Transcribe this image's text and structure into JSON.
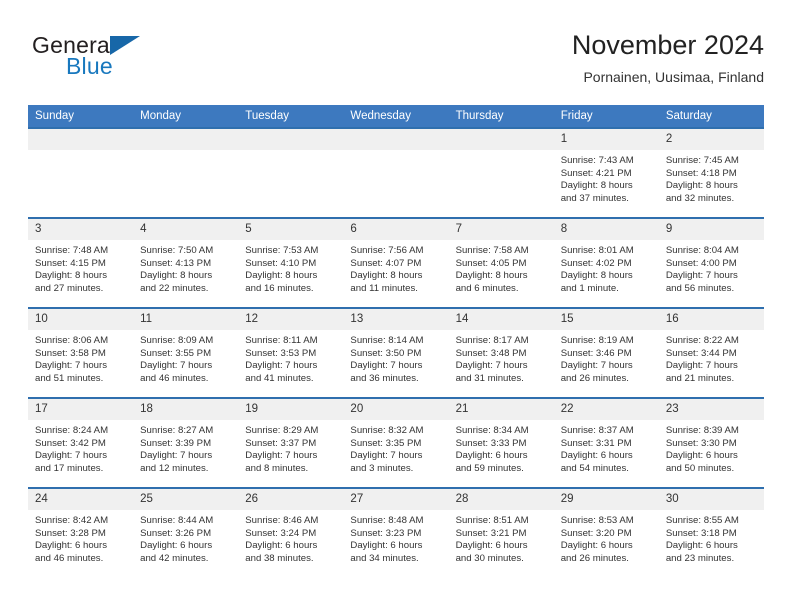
{
  "brand": {
    "name_part1": "General",
    "name_part2": "Blue",
    "logo_icon": "triangle-logo-icon"
  },
  "header": {
    "title": "November 2024",
    "subtitle": "Pornainen, Uusimaa, Finland"
  },
  "colors": {
    "header_blue": "#3d79bf",
    "row_border_blue": "#2f6fae",
    "daynum_band": "#f0f0f0",
    "brand_blue": "#1878be",
    "text": "#333333"
  },
  "weekday_headers": [
    "Sunday",
    "Monday",
    "Tuesday",
    "Wednesday",
    "Thursday",
    "Friday",
    "Saturday"
  ],
  "labels": {
    "sunrise": "Sunrise:",
    "sunset": "Sunset:",
    "daylight": "Daylight:"
  },
  "weeks": [
    [
      {
        "day": "",
        "empty": true
      },
      {
        "day": "",
        "empty": true
      },
      {
        "day": "",
        "empty": true
      },
      {
        "day": "",
        "empty": true
      },
      {
        "day": "",
        "empty": true
      },
      {
        "day": "1",
        "sunrise": "Sunrise: 7:43 AM",
        "sunset": "Sunset: 4:21 PM",
        "daylight_line1": "Daylight: 8 hours",
        "daylight_line2": "and 37 minutes."
      },
      {
        "day": "2",
        "sunrise": "Sunrise: 7:45 AM",
        "sunset": "Sunset: 4:18 PM",
        "daylight_line1": "Daylight: 8 hours",
        "daylight_line2": "and 32 minutes."
      }
    ],
    [
      {
        "day": "3",
        "sunrise": "Sunrise: 7:48 AM",
        "sunset": "Sunset: 4:15 PM",
        "daylight_line1": "Daylight: 8 hours",
        "daylight_line2": "and 27 minutes."
      },
      {
        "day": "4",
        "sunrise": "Sunrise: 7:50 AM",
        "sunset": "Sunset: 4:13 PM",
        "daylight_line1": "Daylight: 8 hours",
        "daylight_line2": "and 22 minutes."
      },
      {
        "day": "5",
        "sunrise": "Sunrise: 7:53 AM",
        "sunset": "Sunset: 4:10 PM",
        "daylight_line1": "Daylight: 8 hours",
        "daylight_line2": "and 16 minutes."
      },
      {
        "day": "6",
        "sunrise": "Sunrise: 7:56 AM",
        "sunset": "Sunset: 4:07 PM",
        "daylight_line1": "Daylight: 8 hours",
        "daylight_line2": "and 11 minutes."
      },
      {
        "day": "7",
        "sunrise": "Sunrise: 7:58 AM",
        "sunset": "Sunset: 4:05 PM",
        "daylight_line1": "Daylight: 8 hours",
        "daylight_line2": "and 6 minutes."
      },
      {
        "day": "8",
        "sunrise": "Sunrise: 8:01 AM",
        "sunset": "Sunset: 4:02 PM",
        "daylight_line1": "Daylight: 8 hours",
        "daylight_line2": "and 1 minute."
      },
      {
        "day": "9",
        "sunrise": "Sunrise: 8:04 AM",
        "sunset": "Sunset: 4:00 PM",
        "daylight_line1": "Daylight: 7 hours",
        "daylight_line2": "and 56 minutes."
      }
    ],
    [
      {
        "day": "10",
        "sunrise": "Sunrise: 8:06 AM",
        "sunset": "Sunset: 3:58 PM",
        "daylight_line1": "Daylight: 7 hours",
        "daylight_line2": "and 51 minutes."
      },
      {
        "day": "11",
        "sunrise": "Sunrise: 8:09 AM",
        "sunset": "Sunset: 3:55 PM",
        "daylight_line1": "Daylight: 7 hours",
        "daylight_line2": "and 46 minutes."
      },
      {
        "day": "12",
        "sunrise": "Sunrise: 8:11 AM",
        "sunset": "Sunset: 3:53 PM",
        "daylight_line1": "Daylight: 7 hours",
        "daylight_line2": "and 41 minutes."
      },
      {
        "day": "13",
        "sunrise": "Sunrise: 8:14 AM",
        "sunset": "Sunset: 3:50 PM",
        "daylight_line1": "Daylight: 7 hours",
        "daylight_line2": "and 36 minutes."
      },
      {
        "day": "14",
        "sunrise": "Sunrise: 8:17 AM",
        "sunset": "Sunset: 3:48 PM",
        "daylight_line1": "Daylight: 7 hours",
        "daylight_line2": "and 31 minutes."
      },
      {
        "day": "15",
        "sunrise": "Sunrise: 8:19 AM",
        "sunset": "Sunset: 3:46 PM",
        "daylight_line1": "Daylight: 7 hours",
        "daylight_line2": "and 26 minutes."
      },
      {
        "day": "16",
        "sunrise": "Sunrise: 8:22 AM",
        "sunset": "Sunset: 3:44 PM",
        "daylight_line1": "Daylight: 7 hours",
        "daylight_line2": "and 21 minutes."
      }
    ],
    [
      {
        "day": "17",
        "sunrise": "Sunrise: 8:24 AM",
        "sunset": "Sunset: 3:42 PM",
        "daylight_line1": "Daylight: 7 hours",
        "daylight_line2": "and 17 minutes."
      },
      {
        "day": "18",
        "sunrise": "Sunrise: 8:27 AM",
        "sunset": "Sunset: 3:39 PM",
        "daylight_line1": "Daylight: 7 hours",
        "daylight_line2": "and 12 minutes."
      },
      {
        "day": "19",
        "sunrise": "Sunrise: 8:29 AM",
        "sunset": "Sunset: 3:37 PM",
        "daylight_line1": "Daylight: 7 hours",
        "daylight_line2": "and 8 minutes."
      },
      {
        "day": "20",
        "sunrise": "Sunrise: 8:32 AM",
        "sunset": "Sunset: 3:35 PM",
        "daylight_line1": "Daylight: 7 hours",
        "daylight_line2": "and 3 minutes."
      },
      {
        "day": "21",
        "sunrise": "Sunrise: 8:34 AM",
        "sunset": "Sunset: 3:33 PM",
        "daylight_line1": "Daylight: 6 hours",
        "daylight_line2": "and 59 minutes."
      },
      {
        "day": "22",
        "sunrise": "Sunrise: 8:37 AM",
        "sunset": "Sunset: 3:31 PM",
        "daylight_line1": "Daylight: 6 hours",
        "daylight_line2": "and 54 minutes."
      },
      {
        "day": "23",
        "sunrise": "Sunrise: 8:39 AM",
        "sunset": "Sunset: 3:30 PM",
        "daylight_line1": "Daylight: 6 hours",
        "daylight_line2": "and 50 minutes."
      }
    ],
    [
      {
        "day": "24",
        "sunrise": "Sunrise: 8:42 AM",
        "sunset": "Sunset: 3:28 PM",
        "daylight_line1": "Daylight: 6 hours",
        "daylight_line2": "and 46 minutes."
      },
      {
        "day": "25",
        "sunrise": "Sunrise: 8:44 AM",
        "sunset": "Sunset: 3:26 PM",
        "daylight_line1": "Daylight: 6 hours",
        "daylight_line2": "and 42 minutes."
      },
      {
        "day": "26",
        "sunrise": "Sunrise: 8:46 AM",
        "sunset": "Sunset: 3:24 PM",
        "daylight_line1": "Daylight: 6 hours",
        "daylight_line2": "and 38 minutes."
      },
      {
        "day": "27",
        "sunrise": "Sunrise: 8:48 AM",
        "sunset": "Sunset: 3:23 PM",
        "daylight_line1": "Daylight: 6 hours",
        "daylight_line2": "and 34 minutes."
      },
      {
        "day": "28",
        "sunrise": "Sunrise: 8:51 AM",
        "sunset": "Sunset: 3:21 PM",
        "daylight_line1": "Daylight: 6 hours",
        "daylight_line2": "and 30 minutes."
      },
      {
        "day": "29",
        "sunrise": "Sunrise: 8:53 AM",
        "sunset": "Sunset: 3:20 PM",
        "daylight_line1": "Daylight: 6 hours",
        "daylight_line2": "and 26 minutes."
      },
      {
        "day": "30",
        "sunrise": "Sunrise: 8:55 AM",
        "sunset": "Sunset: 3:18 PM",
        "daylight_line1": "Daylight: 6 hours",
        "daylight_line2": "and 23 minutes."
      }
    ]
  ]
}
